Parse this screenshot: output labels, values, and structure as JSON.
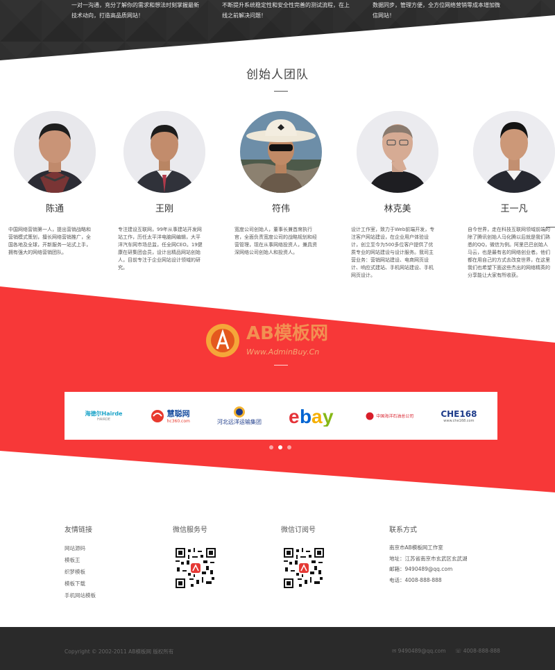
{
  "intro": {
    "col1": "一对一沟通，充分了解你的需求和想法时刻掌握最新技术动向，打造高品质网站！",
    "col2": "不断提升系统稳定性和安全性完善的测试流程，在上线之前解决问题！",
    "col3": "数据同步，管理方便，全方位网络营销零成本增加微信网站！"
  },
  "team": {
    "title": "创始人团队",
    "members": [
      {
        "name": "陈通",
        "bio": "中国网络营销第一人，提出营销战略和营销模式策划，擅长网络营销推广，全国各地及全球，开新服务一站式上手，拥有强大的网络营销团队。"
      },
      {
        "name": "王刚",
        "bio": "专注建设互联网，99年从事建站开发网站工作，历任太平洋电脑网编辑，大平洋汽车网市场总监，任全网CEO。19健康在研集团会员，设计出精品网站创始人，目前专注于企业网站设计领域的研究。"
      },
      {
        "name": "符伟",
        "bio": "宽度公司创始人，董事长兼首席执行官，全面负责宽度公司的战略规划和经营管理，现在从事网络投资人，兼具资深网络公司创始人和投资人。"
      },
      {
        "name": "林克美",
        "bio": "设计工作室，致力于Web前端开发，专注客户网站建设，在企业用户体验设计，创立至今为500多位客户提供了优质专业的网站建设与设计服务。我司主营业务：营销网站建设、电商网页设计、响应式建站、手机网站建设、手机网页设计。"
      },
      {
        "name": "王一凡",
        "bio": "自今世界，走在科技互联网领域前端的除了腾讯创始人马化腾以后就是我们熟悉的QQ，微信为例。阿里巴巴创始人马云，也是最有名的网络创业者。他们都在用自己的方式去改变世界，在这里我们也希望下面这些杰出的网络精英的分享能让大家有所收获。"
      }
    ]
  },
  "partners": {
    "watermark_main": "AB模板网",
    "watermark_sub": "Www.AdminBuy.Cn",
    "logos": [
      {
        "name": "海德尔Hairde",
        "sub": "HAIRDE"
      },
      {
        "name": "慧聪网",
        "sub": "hc360.com"
      },
      {
        "name": "河北远洋运输集团",
        "sub": ""
      },
      {
        "name": "ebay",
        "sub": ""
      },
      {
        "name": "中国海洋石油总公司",
        "sub": ""
      },
      {
        "name": "CHE168",
        "sub": "www.che168.com"
      }
    ]
  },
  "footer": {
    "links_title": "友情链接",
    "links": [
      "网站源码",
      "模板王",
      "织梦模板",
      "模板下载",
      "手机网站模板"
    ],
    "wechat_service_title": "微信服务号",
    "wechat_sub_title": "微信订阅号",
    "contact_title": "联系方式",
    "contact": [
      "南京市AB模板网工作室",
      "地址：江苏省南京市玄武区玄武湖",
      "邮箱：9490489@qq.com",
      "电话：4008-888-888"
    ]
  },
  "bottom": {
    "copyright": "Copyright © 2002-2011 AB模板网 版权所有",
    "email": "9490489@qq.com",
    "phone": "4008-888-888"
  },
  "colors": {
    "red": "#f73838",
    "dark": "#2a2a2a"
  }
}
